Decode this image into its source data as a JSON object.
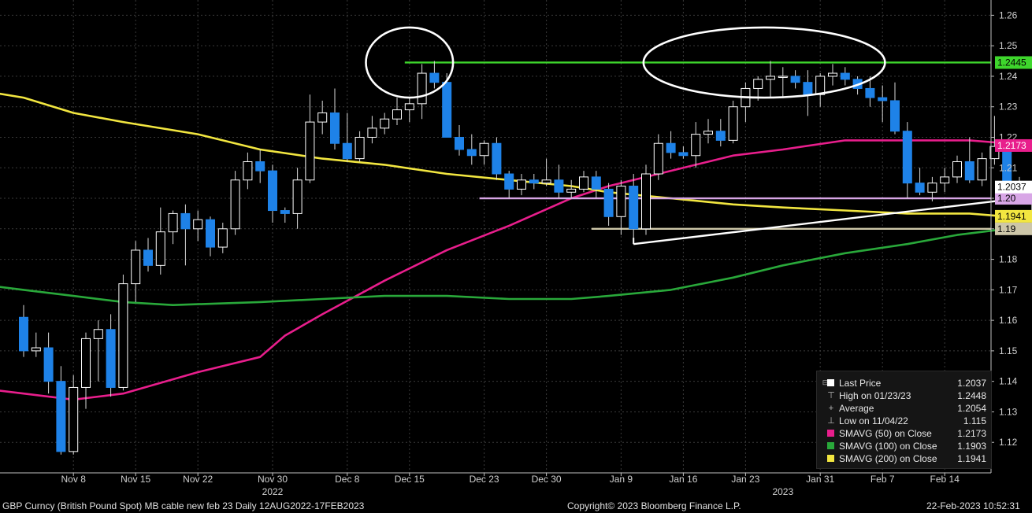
{
  "chart_data": {
    "type": "candlestick",
    "ylim": [
      1.11,
      1.265
    ],
    "y_ticks": [
      1.12,
      1.13,
      1.14,
      1.15,
      1.16,
      1.17,
      1.18,
      1.19,
      1.2,
      1.21,
      1.22,
      1.23,
      1.24,
      1.25,
      1.26
    ],
    "x_ticks": [
      {
        "label": "Nov 8",
        "index": 4
      },
      {
        "label": "Nov 15",
        "index": 9
      },
      {
        "label": "Nov 22",
        "index": 14
      },
      {
        "label": "Nov 30",
        "index": 20
      },
      {
        "label": "Dec 8",
        "index": 26
      },
      {
        "label": "Dec 15",
        "index": 31
      },
      {
        "label": "Dec 23",
        "index": 37
      },
      {
        "label": "Dec 30",
        "index": 42
      },
      {
        "label": "Jan 9",
        "index": 48
      },
      {
        "label": "Jan 16",
        "index": 53
      },
      {
        "label": "Jan 23",
        "index": 58
      },
      {
        "label": "Jan 31",
        "index": 64
      },
      {
        "label": "Feb 7",
        "index": 69
      },
      {
        "label": "Feb 14",
        "index": 74
      }
    ],
    "year_labels": [
      {
        "label": "2022",
        "index": 20
      },
      {
        "label": "2023",
        "index": 61
      }
    ],
    "candles": [
      {
        "o": 1.161,
        "h": 1.165,
        "l": 1.148,
        "c": 1.15
      },
      {
        "o": 1.15,
        "h": 1.156,
        "l": 1.148,
        "c": 1.151
      },
      {
        "o": 1.151,
        "h": 1.156,
        "l": 1.136,
        "c": 1.14
      },
      {
        "o": 1.14,
        "h": 1.145,
        "l": 1.116,
        "c": 1.117
      },
      {
        "o": 1.117,
        "h": 1.142,
        "l": 1.116,
        "c": 1.138
      },
      {
        "o": 1.138,
        "h": 1.156,
        "l": 1.131,
        "c": 1.154
      },
      {
        "o": 1.154,
        "h": 1.16,
        "l": 1.14,
        "c": 1.157
      },
      {
        "o": 1.157,
        "h": 1.162,
        "l": 1.135,
        "c": 1.138
      },
      {
        "o": 1.138,
        "h": 1.175,
        "l": 1.137,
        "c": 1.172
      },
      {
        "o": 1.172,
        "h": 1.186,
        "l": 1.166,
        "c": 1.183
      },
      {
        "o": 1.183,
        "h": 1.187,
        "l": 1.176,
        "c": 1.178
      },
      {
        "o": 1.178,
        "h": 1.197,
        "l": 1.175,
        "c": 1.189
      },
      {
        "o": 1.189,
        "h": 1.196,
        "l": 1.185,
        "c": 1.195
      },
      {
        "o": 1.195,
        "h": 1.198,
        "l": 1.178,
        "c": 1.19
      },
      {
        "o": 1.19,
        "h": 1.196,
        "l": 1.186,
        "c": 1.193
      },
      {
        "o": 1.193,
        "h": 1.194,
        "l": 1.181,
        "c": 1.184
      },
      {
        "o": 1.184,
        "h": 1.192,
        "l": 1.182,
        "c": 1.19
      },
      {
        "o": 1.19,
        "h": 1.209,
        "l": 1.188,
        "c": 1.206
      },
      {
        "o": 1.206,
        "h": 1.215,
        "l": 1.203,
        "c": 1.212
      },
      {
        "o": 1.212,
        "h": 1.216,
        "l": 1.205,
        "c": 1.209
      },
      {
        "o": 1.209,
        "h": 1.211,
        "l": 1.192,
        "c": 1.196
      },
      {
        "o": 1.196,
        "h": 1.197,
        "l": 1.192,
        "c": 1.195
      },
      {
        "o": 1.195,
        "h": 1.21,
        "l": 1.19,
        "c": 1.206
      },
      {
        "o": 1.206,
        "h": 1.234,
        "l": 1.205,
        "c": 1.225
      },
      {
        "o": 1.225,
        "h": 1.232,
        "l": 1.221,
        "c": 1.228
      },
      {
        "o": 1.228,
        "h": 1.236,
        "l": 1.216,
        "c": 1.218
      },
      {
        "o": 1.218,
        "h": 1.228,
        "l": 1.212,
        "c": 1.213
      },
      {
        "o": 1.213,
        "h": 1.222,
        "l": 1.212,
        "c": 1.22
      },
      {
        "o": 1.22,
        "h": 1.227,
        "l": 1.218,
        "c": 1.223
      },
      {
        "o": 1.223,
        "h": 1.228,
        "l": 1.221,
        "c": 1.226
      },
      {
        "o": 1.226,
        "h": 1.233,
        "l": 1.224,
        "c": 1.229
      },
      {
        "o": 1.229,
        "h": 1.233,
        "l": 1.225,
        "c": 1.231
      },
      {
        "o": 1.231,
        "h": 1.244,
        "l": 1.226,
        "c": 1.241
      },
      {
        "o": 1.241,
        "h": 1.245,
        "l": 1.236,
        "c": 1.238
      },
      {
        "o": 1.238,
        "h": 1.241,
        "l": 1.221,
        "c": 1.22
      },
      {
        "o": 1.22,
        "h": 1.224,
        "l": 1.214,
        "c": 1.216
      },
      {
        "o": 1.216,
        "h": 1.221,
        "l": 1.211,
        "c": 1.214
      },
      {
        "o": 1.214,
        "h": 1.219,
        "l": 1.211,
        "c": 1.218
      },
      {
        "o": 1.218,
        "h": 1.22,
        "l": 1.206,
        "c": 1.208
      },
      {
        "o": 1.208,
        "h": 1.209,
        "l": 1.2,
        "c": 1.203
      },
      {
        "o": 1.203,
        "h": 1.208,
        "l": 1.201,
        "c": 1.206
      },
      {
        "o": 1.206,
        "h": 1.208,
        "l": 1.203,
        "c": 1.205
      },
      {
        "o": 1.205,
        "h": 1.213,
        "l": 1.204,
        "c": 1.206
      },
      {
        "o": 1.206,
        "h": 1.211,
        "l": 1.2,
        "c": 1.202
      },
      {
        "o": 1.202,
        "h": 1.206,
        "l": 1.2,
        "c": 1.203
      },
      {
        "o": 1.203,
        "h": 1.209,
        "l": 1.202,
        "c": 1.207
      },
      {
        "o": 1.207,
        "h": 1.209,
        "l": 1.2,
        "c": 1.203
      },
      {
        "o": 1.203,
        "h": 1.205,
        "l": 1.191,
        "c": 1.194
      },
      {
        "o": 1.194,
        "h": 1.206,
        "l": 1.188,
        "c": 1.204
      },
      {
        "o": 1.204,
        "h": 1.208,
        "l": 1.185,
        "c": 1.19
      },
      {
        "o": 1.19,
        "h": 1.211,
        "l": 1.188,
        "c": 1.208
      },
      {
        "o": 1.208,
        "h": 1.221,
        "l": 1.206,
        "c": 1.218
      },
      {
        "o": 1.218,
        "h": 1.222,
        "l": 1.213,
        "c": 1.215
      },
      {
        "o": 1.215,
        "h": 1.217,
        "l": 1.213,
        "c": 1.214
      },
      {
        "o": 1.214,
        "h": 1.225,
        "l": 1.21,
        "c": 1.221
      },
      {
        "o": 1.221,
        "h": 1.226,
        "l": 1.218,
        "c": 1.222
      },
      {
        "o": 1.222,
        "h": 1.226,
        "l": 1.217,
        "c": 1.219
      },
      {
        "o": 1.219,
        "h": 1.232,
        "l": 1.218,
        "c": 1.23
      },
      {
        "o": 1.23,
        "h": 1.238,
        "l": 1.225,
        "c": 1.236
      },
      {
        "o": 1.236,
        "h": 1.24,
        "l": 1.232,
        "c": 1.239
      },
      {
        "o": 1.239,
        "h": 1.245,
        "l": 1.233,
        "c": 1.24
      },
      {
        "o": 1.24,
        "h": 1.243,
        "l": 1.233,
        "c": 1.24
      },
      {
        "o": 1.24,
        "h": 1.242,
        "l": 1.236,
        "c": 1.238
      },
      {
        "o": 1.238,
        "h": 1.242,
        "l": 1.227,
        "c": 1.234
      },
      {
        "o": 1.234,
        "h": 1.241,
        "l": 1.23,
        "c": 1.24
      },
      {
        "o": 1.24,
        "h": 1.244,
        "l": 1.237,
        "c": 1.241
      },
      {
        "o": 1.241,
        "h": 1.243,
        "l": 1.237,
        "c": 1.239
      },
      {
        "o": 1.239,
        "h": 1.24,
        "l": 1.234,
        "c": 1.236
      },
      {
        "o": 1.236,
        "h": 1.24,
        "l": 1.23,
        "c": 1.233
      },
      {
        "o": 1.233,
        "h": 1.237,
        "l": 1.225,
        "c": 1.232
      },
      {
        "o": 1.232,
        "h": 1.238,
        "l": 1.221,
        "c": 1.222
      },
      {
        "o": 1.222,
        "h": 1.225,
        "l": 1.2,
        "c": 1.205
      },
      {
        "o": 1.205,
        "h": 1.21,
        "l": 1.201,
        "c": 1.202
      },
      {
        "o": 1.202,
        "h": 1.207,
        "l": 1.199,
        "c": 1.205
      },
      {
        "o": 1.205,
        "h": 1.21,
        "l": 1.202,
        "c": 1.207
      },
      {
        "o": 1.207,
        "h": 1.214,
        "l": 1.205,
        "c": 1.212
      },
      {
        "o": 1.212,
        "h": 1.22,
        "l": 1.205,
        "c": 1.206
      },
      {
        "o": 1.206,
        "h": 1.215,
        "l": 1.204,
        "c": 1.213
      },
      {
        "o": 1.213,
        "h": 1.227,
        "l": 1.211,
        "c": 1.217
      },
      {
        "o": 1.217,
        "h": 1.218,
        "l": 1.199,
        "c": 1.203
      },
      {
        "o": 1.203,
        "h": 1.207,
        "l": 1.198,
        "c": 1.2
      },
      {
        "o": 1.2,
        "h": 1.205,
        "l": 1.191,
        "c": 1.204
      }
    ],
    "series": [
      {
        "name": "SMAVG (50) on Close",
        "color": "#e81e8c",
        "x": [
          -6,
          0,
          4,
          8,
          14,
          19,
          21,
          24,
          29,
          34,
          39,
          44,
          47,
          52,
          57,
          61,
          66,
          71,
          76,
          79
        ],
        "values": [
          1.139,
          1.136,
          1.134,
          1.136,
          1.143,
          1.148,
          1.155,
          1.162,
          1.173,
          1.183,
          1.191,
          1.2,
          1.204,
          1.209,
          1.214,
          1.216,
          1.219,
          1.219,
          1.219,
          1.218
        ]
      },
      {
        "name": "SMAVG (100) on Close",
        "color": "#29a83a",
        "x": [
          -6,
          0,
          4,
          8,
          12,
          19,
          24,
          29,
          34,
          39,
          44,
          47,
          52,
          57,
          61,
          66,
          71,
          75,
          77,
          79
        ],
        "values": [
          1.173,
          1.17,
          1.168,
          1.166,
          1.165,
          1.166,
          1.167,
          1.168,
          1.168,
          1.167,
          1.167,
          1.168,
          1.17,
          1.174,
          1.178,
          1.182,
          1.185,
          1.188,
          1.189,
          1.19
        ]
      },
      {
        "name": "SMAVG (200) on Close",
        "color": "#f2e640",
        "x": [
          -6,
          0,
          4,
          8,
          14,
          19,
          24,
          29,
          34,
          39,
          44,
          47,
          52,
          57,
          61,
          66,
          71,
          76,
          79
        ],
        "values": [
          1.237,
          1.233,
          1.228,
          1.225,
          1.221,
          1.216,
          1.213,
          1.211,
          1.208,
          1.206,
          1.204,
          1.202,
          1.2,
          1.198,
          1.197,
          1.196,
          1.195,
          1.195,
          1.194
        ]
      }
    ],
    "levels": [
      {
        "value": 1.2445,
        "color": "#3ed62c",
        "from_index": 31,
        "label": "1.2445",
        "label_bg": "#3ed62c",
        "label_fg": "#000000"
      },
      {
        "value": 1.2,
        "color": "#d8a6e6",
        "from_index": 37,
        "label": "1.20",
        "label_bg": "#d8a6e6",
        "label_fg": "#000000"
      },
      {
        "value": 1.19,
        "color": "#cdc6a8",
        "from_index": 46,
        "label": "1.19",
        "label_bg": "#cdc6a8",
        "label_fg": "#000000"
      }
    ],
    "price_tags": [
      {
        "value": 1.2173,
        "label": "1.2173",
        "bg": "#e81e8c",
        "fg": "#ffffff"
      },
      {
        "value": 1.2037,
        "label": "1.2037",
        "bg": "#ffffff",
        "fg": "#000000"
      },
      {
        "value": 1.1941,
        "label": "1.1941",
        "bg": "#f2e640",
        "fg": "#000000"
      }
    ],
    "trendline": {
      "color": "#ffffff",
      "points": [
        [
          49,
          1.185
        ],
        [
          80,
          1.2
        ]
      ]
    },
    "annotations": [
      {
        "type": "ellipse",
        "color": "#ffffff",
        "center_index": 31,
        "center_value": 1.2445,
        "rx_bars": 3.5,
        "ry_value": 0.0115
      },
      {
        "type": "ellipse",
        "color": "#ffffff",
        "center_index": 59.5,
        "center_value": 1.2445,
        "rx_bars": 9.7,
        "ry_value": 0.0115
      }
    ],
    "up_color": "#ffffff",
    "down_color": "#1e82e8"
  },
  "legend": {
    "rows": [
      {
        "sym": "⊟",
        "swatch": "#ffffff",
        "glyph": "",
        "name": "Last Price",
        "value": "1.2037"
      },
      {
        "sym": "",
        "swatch": "",
        "glyph": "⊤",
        "name": "High on 01/23/23",
        "value": "1.2448"
      },
      {
        "sym": "",
        "swatch": "",
        "glyph": "+",
        "name": "Average",
        "value": "1.2054"
      },
      {
        "sym": "",
        "swatch": "",
        "glyph": "⊥",
        "name": "Low on 11/04/22",
        "value": "1.115"
      },
      {
        "sym": "",
        "swatch": "#e81e8c",
        "glyph": "",
        "name": "SMAVG (50)  on Close",
        "value": "1.2173"
      },
      {
        "sym": "",
        "swatch": "#29a83a",
        "glyph": "",
        "name": "SMAVG (100)  on Close",
        "value": "1.1903"
      },
      {
        "sym": "",
        "swatch": "#f2e640",
        "glyph": "",
        "name": "SMAVG (200)  on Close",
        "value": "1.1941"
      }
    ]
  },
  "footer": {
    "left": "GBP Curncy (British Pound Spot) MB cable new feb 23  Daily 12AUG2022-17FEB2023",
    "center": "Copyright© 2023 Bloomberg Finance L.P.",
    "right": "22-Feb-2023 10:52:31"
  }
}
